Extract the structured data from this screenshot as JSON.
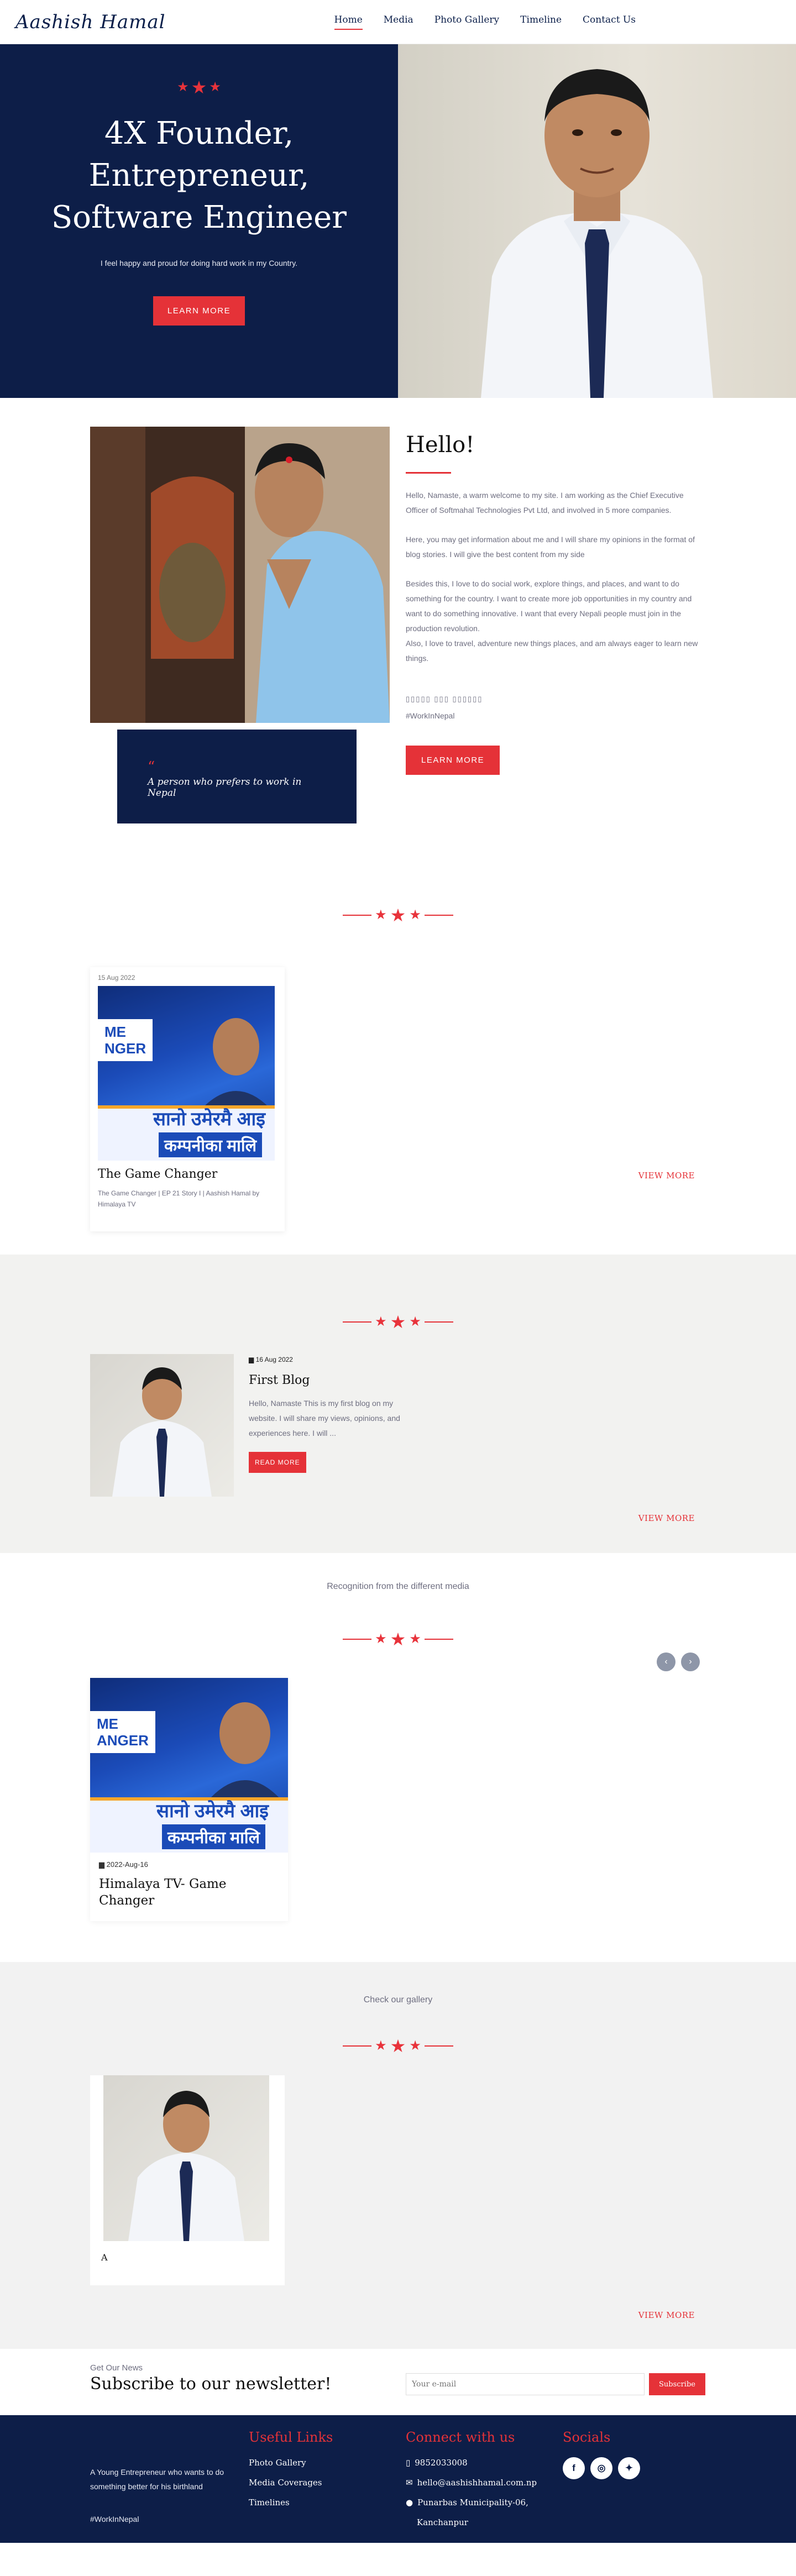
{
  "header": {
    "logo": "Aashish Hamal",
    "nav": [
      "Home",
      "Media",
      "Photo Gallery",
      "Timeline",
      "Contact Us"
    ]
  },
  "hero": {
    "title_line1": "4X Founder,",
    "title_line2": "Entrepreneur,",
    "title_line3": "Software Engineer",
    "tagline": "I feel happy and proud for doing hard work in my Country.",
    "button": "LEARN MORE"
  },
  "about": {
    "heading": "Hello!",
    "para1": "Hello, Namaste, a warm welcome to my site. I am working as the Chief Executive Officer of Softmahal Technologies Pvt Ltd, and involved in 5 more companies.",
    "para2": "Here, you may get information about me and I will share my opinions in the format of blog stories.  I will give the best content from my side",
    "para3": "Besides this, I love to do social work, explore things, and places, and want to do something for the country. I want to create more job opportunities in my country and want to do something innovative. I want that every Nepali people must join in the production revolution.",
    "para4": " Also, I love to travel, adventure new things places, and am always eager to learn new things.",
    "hashline": "▯▯▯▯▯ ▯▯▯ ▯▯▯▯▯▯",
    "hashtag": "#WorkInNepal",
    "quote": "A person who prefers to work in Nepal",
    "button": "LEARN MORE"
  },
  "media": {
    "card_date": "15 Aug 2022",
    "card_title": "The Game Changer",
    "card_desc": "The Game Changer | EP 21 Story I | Aashish Hamal by Himalaya TV",
    "thumb_top": "ME\nNGER",
    "thumb_line1": "सानो उमेरमै आइ",
    "thumb_line2": "कम्पनीका मालि",
    "view_more": "VIEW MORE"
  },
  "blog": {
    "date": "16 Aug 2022",
    "title": "First Blog",
    "excerpt": "Hello, Namaste This is my first blog on my website. I will share my views, opinions, and experiences here. I will ...",
    "button": "READ MORE",
    "view_more": "VIEW MORE"
  },
  "recognition": {
    "kicker": "Recognition from the different media",
    "card_date": "2022-Aug-16",
    "card_title": "Himalaya TV- Game Changer",
    "thumb_top": "ME\nANGER",
    "thumb_line1": "सानो उमेरमै आइ",
    "thumb_line2": "कम्पनीका मालि",
    "prev": "‹",
    "next": "›"
  },
  "gallery": {
    "kicker": "Check our gallery",
    "caption": "A",
    "view_more": "VIEW MORE"
  },
  "newsletter": {
    "kicker": "Get Our News",
    "title": "Subscribe to our newsletter!",
    "placeholder": "Your e-mail",
    "button": "Subscribe"
  },
  "footer": {
    "about": "A Young Entrepreneur who wants to do something better for his birthland",
    "hashtag": "#WorkInNepal",
    "useful_heading": "Useful Links",
    "useful_links": [
      "Photo Gallery",
      "Media Coverages",
      "Timelines"
    ],
    "connect_heading": "Connect with us",
    "phone": "9852033008",
    "email": "hello@aashishhamal.com.np",
    "address_line1": "Punarbas Municipality-06,",
    "address_line2": "Kanchanpur",
    "socials_heading": "Socials",
    "social_icons": [
      "facebook-icon",
      "instagram-icon",
      "twitter-icon"
    ]
  },
  "colors": {
    "navy": "#0d1e48",
    "accent": "#e53238"
  }
}
